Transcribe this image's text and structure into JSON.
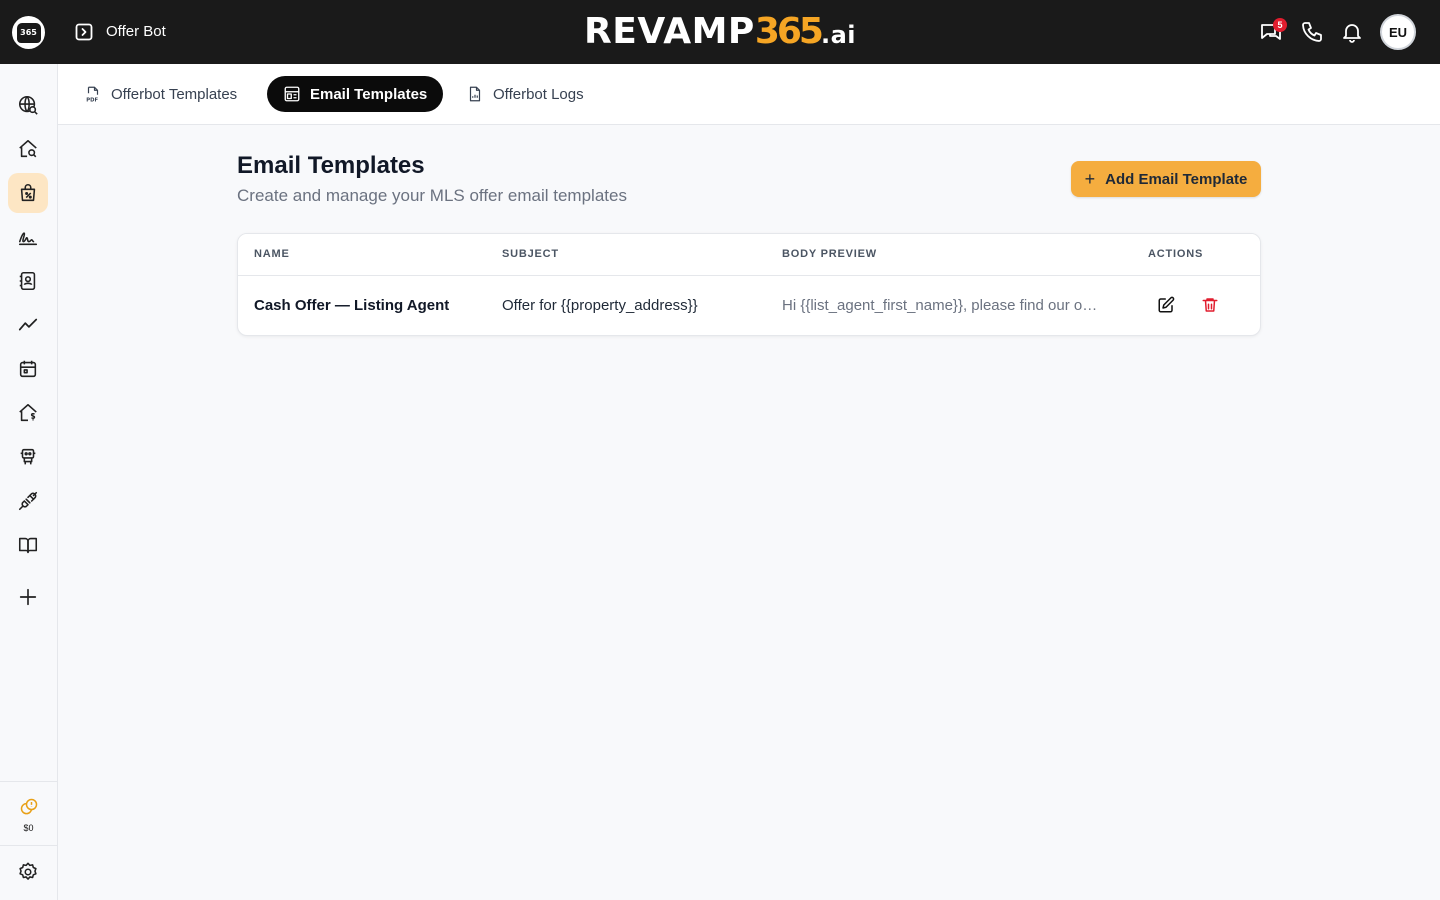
{
  "topbar": {
    "app_logo_text": "365",
    "page_name": "Offer Bot",
    "brand": {
      "main": "REVAMP",
      "num": "365",
      "suffix": ".ai"
    },
    "notification_count": "5",
    "avatar_initials": "EU"
  },
  "sidebar": {
    "items": [
      {
        "icon": "globe-search-icon"
      },
      {
        "icon": "home-search-icon"
      },
      {
        "icon": "shopping-bag-percent-icon",
        "active": true
      },
      {
        "icon": "signature-icon"
      },
      {
        "icon": "contact-book-icon"
      },
      {
        "icon": "trend-line-icon"
      },
      {
        "icon": "calendar-icon"
      },
      {
        "icon": "home-dollar-icon"
      },
      {
        "icon": "robot-icon"
      },
      {
        "icon": "plug-icon"
      },
      {
        "icon": "book-open-icon"
      },
      {
        "icon": "plus-icon"
      }
    ],
    "credits": "$0"
  },
  "tabs": [
    {
      "label": "Offerbot Templates",
      "icon": "pdf-file-icon"
    },
    {
      "label": "Email Templates",
      "icon": "template-layout-icon",
      "active": true
    },
    {
      "label": "Offerbot Logs",
      "icon": "file-chart-icon"
    }
  ],
  "main": {
    "title": "Email Templates",
    "subtitle": "Create and manage your MLS offer email templates",
    "add_button": "Add Email Template"
  },
  "table": {
    "columns": [
      "NAME",
      "SUBJECT",
      "BODY PREVIEW",
      "ACTIONS"
    ],
    "rows": [
      {
        "name": "Cash Offer — Listing Agent",
        "subject": "Offer for {{property_address}}",
        "preview": "Hi {{list_agent_first_name}}, please find our o…"
      }
    ]
  },
  "colors": {
    "accent": "#f5ad3f",
    "brand_orange": "#f5a524",
    "topbar": "#1a1a1a",
    "active_side": "#fde6c4",
    "delete": "#e11d2e"
  }
}
